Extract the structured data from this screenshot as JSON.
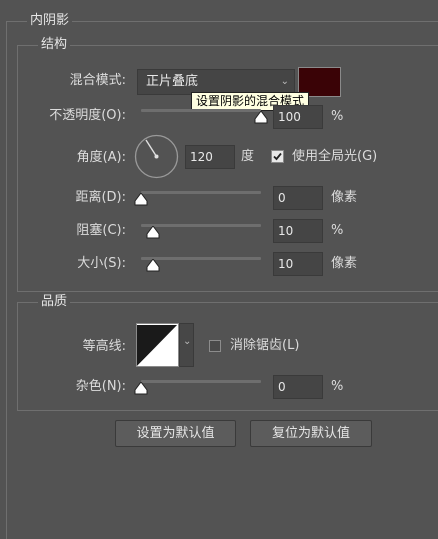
{
  "panel": {
    "title": "内阴影"
  },
  "structure": {
    "title": "结构",
    "blend_mode": {
      "label": "混合模式:",
      "value": "正片叠底",
      "color": "#3a0306"
    },
    "tooltip": "设置阴影的混合模式",
    "opacity": {
      "label": "不透明度(O):",
      "value": "100",
      "unit": "%",
      "level_percent": 100
    },
    "angle": {
      "label": "角度(A):",
      "value": "120",
      "unit": "度",
      "global_light_label": "使用全局光(G)",
      "global_light_checked": true
    },
    "distance": {
      "label": "距离(D):",
      "value": "0",
      "unit": "像素",
      "level_percent": 0
    },
    "choke": {
      "label": "阻塞(C):",
      "value": "10",
      "unit": "%",
      "level_percent": 10
    },
    "size": {
      "label": "大小(S):",
      "value": "10",
      "unit": "像素",
      "level_percent": 10
    }
  },
  "quality": {
    "title": "品质",
    "contour": {
      "label": "等高线:",
      "anti_alias_label": "消除锯齿(L)",
      "anti_alias_checked": false
    },
    "noise": {
      "label": "杂色(N):",
      "value": "0",
      "unit": "%",
      "level_percent": 0
    }
  },
  "buttons": {
    "set_default": "设置为默认值",
    "reset_default": "复位为默认值"
  },
  "icons": {
    "dropdown": "chevron-down-icon",
    "checkbox": "checkmark-icon",
    "slider": "slider-thumb-icon",
    "angle": "angle-dial-icon"
  }
}
